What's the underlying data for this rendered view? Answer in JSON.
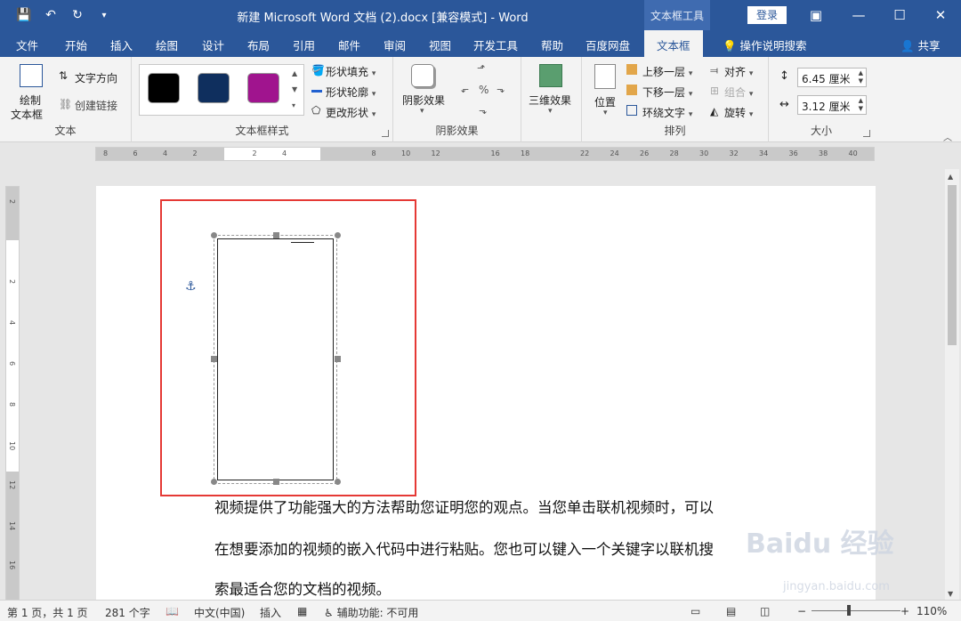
{
  "window": {
    "title": "新建 Microsoft Word 文档 (2).docx [兼容模式]  -  Word",
    "context_group": "文本框工具",
    "login": "登录",
    "qat": [
      "save-icon",
      "undo-icon",
      "redo-icon",
      "customize-icon"
    ]
  },
  "tabs": [
    "文件",
    "开始",
    "插入",
    "绘图",
    "设计",
    "布局",
    "引用",
    "邮件",
    "审阅",
    "视图",
    "开发工具",
    "帮助",
    "百度网盘",
    "文本框"
  ],
  "active_tab": "文本框",
  "tell_me": "操作说明搜索",
  "share": "共享",
  "ribbon": {
    "text_group": {
      "label": "文本",
      "draw_textbox_line1": "绘制",
      "draw_textbox_line2": "文本框",
      "text_direction": "文字方向",
      "create_link": "创建链接"
    },
    "styles_group": {
      "label": "文本框样式",
      "swatches": [
        "#000000",
        "#0f2f5e",
        "#a0148e"
      ],
      "shape_fill": "形状填充",
      "shape_outline": "形状轮廓",
      "change_shape": "更改形状"
    },
    "shadow_group": {
      "label": "阴影效果",
      "shadow_effect": "阴影效果"
    },
    "threed_group": {
      "three_d": "三维效果"
    },
    "arrange_group": {
      "label": "排列",
      "position": "位置",
      "bring_forward": "上移一层",
      "send_backward": "下移一层",
      "wrap_text": "环绕文字",
      "align": "对齐",
      "group": "组合",
      "rotate": "旋转"
    },
    "size_group": {
      "label": "大小",
      "height": "6.45 厘米",
      "width": "3.12 厘米"
    }
  },
  "ruler_ticks": [
    "8",
    "6",
    "4",
    "2",
    "",
    "2",
    "4",
    "",
    "",
    "8",
    "10",
    "12",
    "",
    "16",
    "18",
    "",
    "22",
    "24",
    "26",
    "28",
    "30",
    "32",
    "34",
    "36",
    "38",
    "40"
  ],
  "document": {
    "lines": [
      "视频提供了功能强大的方法帮助您证明您的观点。当您单击联机视频时，可以",
      "在想要添加的视频的嵌入代码中进行粘贴。您也可以键入一个关键字以联机搜",
      "索最适合您的文档的视频。"
    ]
  },
  "status": {
    "page": "第 1 页，共 1 页",
    "words": "281 个字",
    "language": "中文(中国)",
    "mode": "插入",
    "accessibility": "辅助功能: 不可用",
    "zoom": "110%"
  },
  "watermark": {
    "brand": "Baidu 经验",
    "url": "jingyan.baidu.com"
  },
  "colors": {
    "brand": "#2b579a",
    "highlight": "#e53935"
  }
}
